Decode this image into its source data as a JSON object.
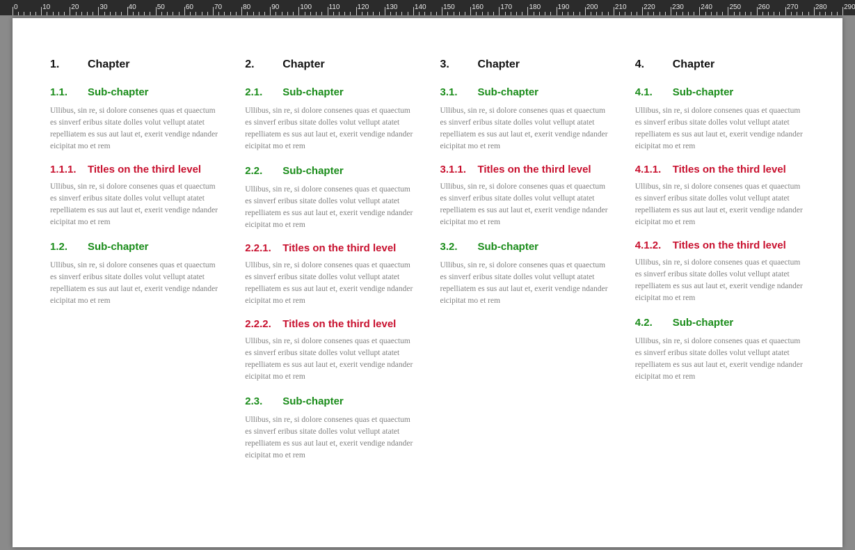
{
  "ruler": {
    "unit": "mm",
    "start": 0,
    "end": 290,
    "major_step": 10,
    "minor_step": 2
  },
  "body_text": "Ullibus, sin re, si dolore consenes quas et quaectum es sinverf eribus sitate dolles volut vellupt atatet repelliatem es sus aut laut et, exerit vendige ndander eicipitat mo et rem",
  "labels": {
    "chapter": "Chapter",
    "sub_chapter": "Sub-chapter",
    "third_level": "Titles on the third level"
  },
  "columns": [
    {
      "chapter_num": "1.",
      "blocks": [
        {
          "type": "h2",
          "num": "1.1.",
          "label_key": "sub_chapter"
        },
        {
          "type": "body"
        },
        {
          "type": "h3",
          "num": "1.1.1.",
          "label_key": "third_level"
        },
        {
          "type": "body"
        },
        {
          "type": "h2",
          "num": "1.2.",
          "label_key": "sub_chapter"
        },
        {
          "type": "body"
        }
      ]
    },
    {
      "chapter_num": "2.",
      "blocks": [
        {
          "type": "h2",
          "num": "2.1.",
          "label_key": "sub_chapter"
        },
        {
          "type": "body"
        },
        {
          "type": "h2",
          "num": "2.2.",
          "label_key": "sub_chapter"
        },
        {
          "type": "body"
        },
        {
          "type": "h3",
          "num": "2.2.1.",
          "label_key": "third_level"
        },
        {
          "type": "body"
        },
        {
          "type": "h3",
          "num": "2.2.2.",
          "label_key": "third_level"
        },
        {
          "type": "body"
        },
        {
          "type": "h2",
          "num": "2.3.",
          "label_key": "sub_chapter"
        },
        {
          "type": "body"
        }
      ]
    },
    {
      "chapter_num": "3.",
      "blocks": [
        {
          "type": "h2",
          "num": "3.1.",
          "label_key": "sub_chapter"
        },
        {
          "type": "body"
        },
        {
          "type": "h3",
          "num": "3.1.1.",
          "label_key": "third_level"
        },
        {
          "type": "body"
        },
        {
          "type": "h2",
          "num": "3.2.",
          "label_key": "sub_chapter"
        },
        {
          "type": "body"
        }
      ]
    },
    {
      "chapter_num": "4.",
      "blocks": [
        {
          "type": "h2",
          "num": "4.1.",
          "label_key": "sub_chapter"
        },
        {
          "type": "body"
        },
        {
          "type": "h3",
          "num": "4.1.1.",
          "label_key": "third_level"
        },
        {
          "type": "body"
        },
        {
          "type": "h3",
          "num": "4.1.2.",
          "label_key": "third_level"
        },
        {
          "type": "body"
        },
        {
          "type": "h2",
          "num": "4.2.",
          "label_key": "sub_chapter"
        },
        {
          "type": "body"
        }
      ]
    }
  ]
}
